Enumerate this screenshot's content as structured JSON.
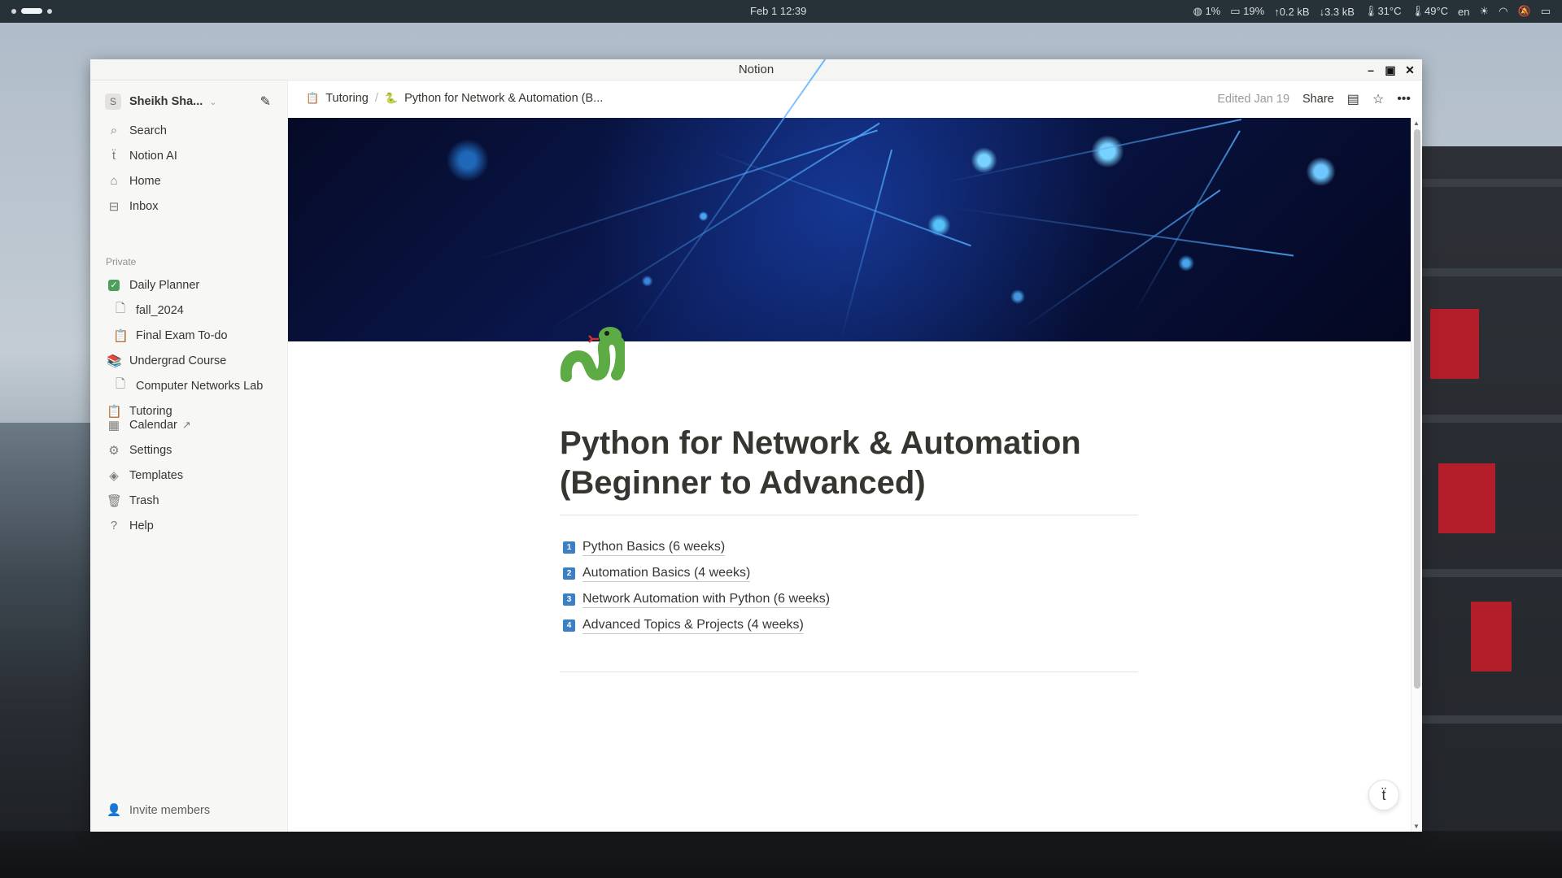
{
  "topbar": {
    "clock": "Feb 1  12:39",
    "cpu": "1%",
    "ram": "19%",
    "upload": "0.2 kB",
    "download": "3.3 kB",
    "temp1": "31°C",
    "temp2": "49°C",
    "lang": "en"
  },
  "window": {
    "title": "Notion"
  },
  "sidebar": {
    "workspace_initial": "S",
    "workspace_name": "Sheikh Sha...",
    "top_items": [
      {
        "label": "Search",
        "icon": "search-icon"
      },
      {
        "label": "Notion AI",
        "icon": "notion-ai-icon"
      },
      {
        "label": "Home",
        "icon": "home-icon"
      },
      {
        "label": "Inbox",
        "icon": "inbox-icon"
      }
    ],
    "section_label": "Private",
    "private_items": [
      {
        "label": "Daily Planner",
        "icon": "checkbox-icon",
        "level": 0
      },
      {
        "label": "fall_2024",
        "icon": "page-icon",
        "level": 1
      },
      {
        "label": "Final Exam To-do",
        "icon": "clipboard-icon",
        "level": 1
      },
      {
        "label": "Undergrad Course",
        "icon": "books-icon",
        "level": 0
      },
      {
        "label": "Computer Networks Lab",
        "icon": "page-icon",
        "level": 1
      },
      {
        "label": "Tutoring",
        "icon": "clipboard-icon",
        "level": 0
      }
    ],
    "bottom_items": [
      {
        "label": "Calendar",
        "icon": "calendar-icon",
        "suffix": "↗"
      },
      {
        "label": "Settings",
        "icon": "gear-icon"
      },
      {
        "label": "Templates",
        "icon": "templates-icon"
      },
      {
        "label": "Trash",
        "icon": "trash-icon"
      },
      {
        "label": "Help",
        "icon": "help-icon"
      }
    ],
    "invite_label": "Invite members"
  },
  "header": {
    "breadcrumb": [
      {
        "label": "Tutoring",
        "icon": "clipboard-icon"
      },
      {
        "label": "Python for Network & Automation (B...",
        "icon": "snake-icon"
      }
    ],
    "edited": "Edited Jan 19",
    "share": "Share"
  },
  "page": {
    "icon": "snake-icon",
    "title": "Python for Network & Automation (Beginner to Advanced)",
    "items": [
      {
        "num": "1",
        "label": "Python Basics (6 weeks)"
      },
      {
        "num": "2",
        "label": "Automation Basics (4 weeks)"
      },
      {
        "num": "3",
        "label": "Network Automation with Python (6 weeks)"
      },
      {
        "num": "4",
        "label": "Advanced Topics & Projects (4 weeks)"
      }
    ]
  },
  "colors": {
    "accent_blue": "#3d7fc4",
    "text": "#37352f",
    "sidebar_bg": "#f7f7f5"
  }
}
